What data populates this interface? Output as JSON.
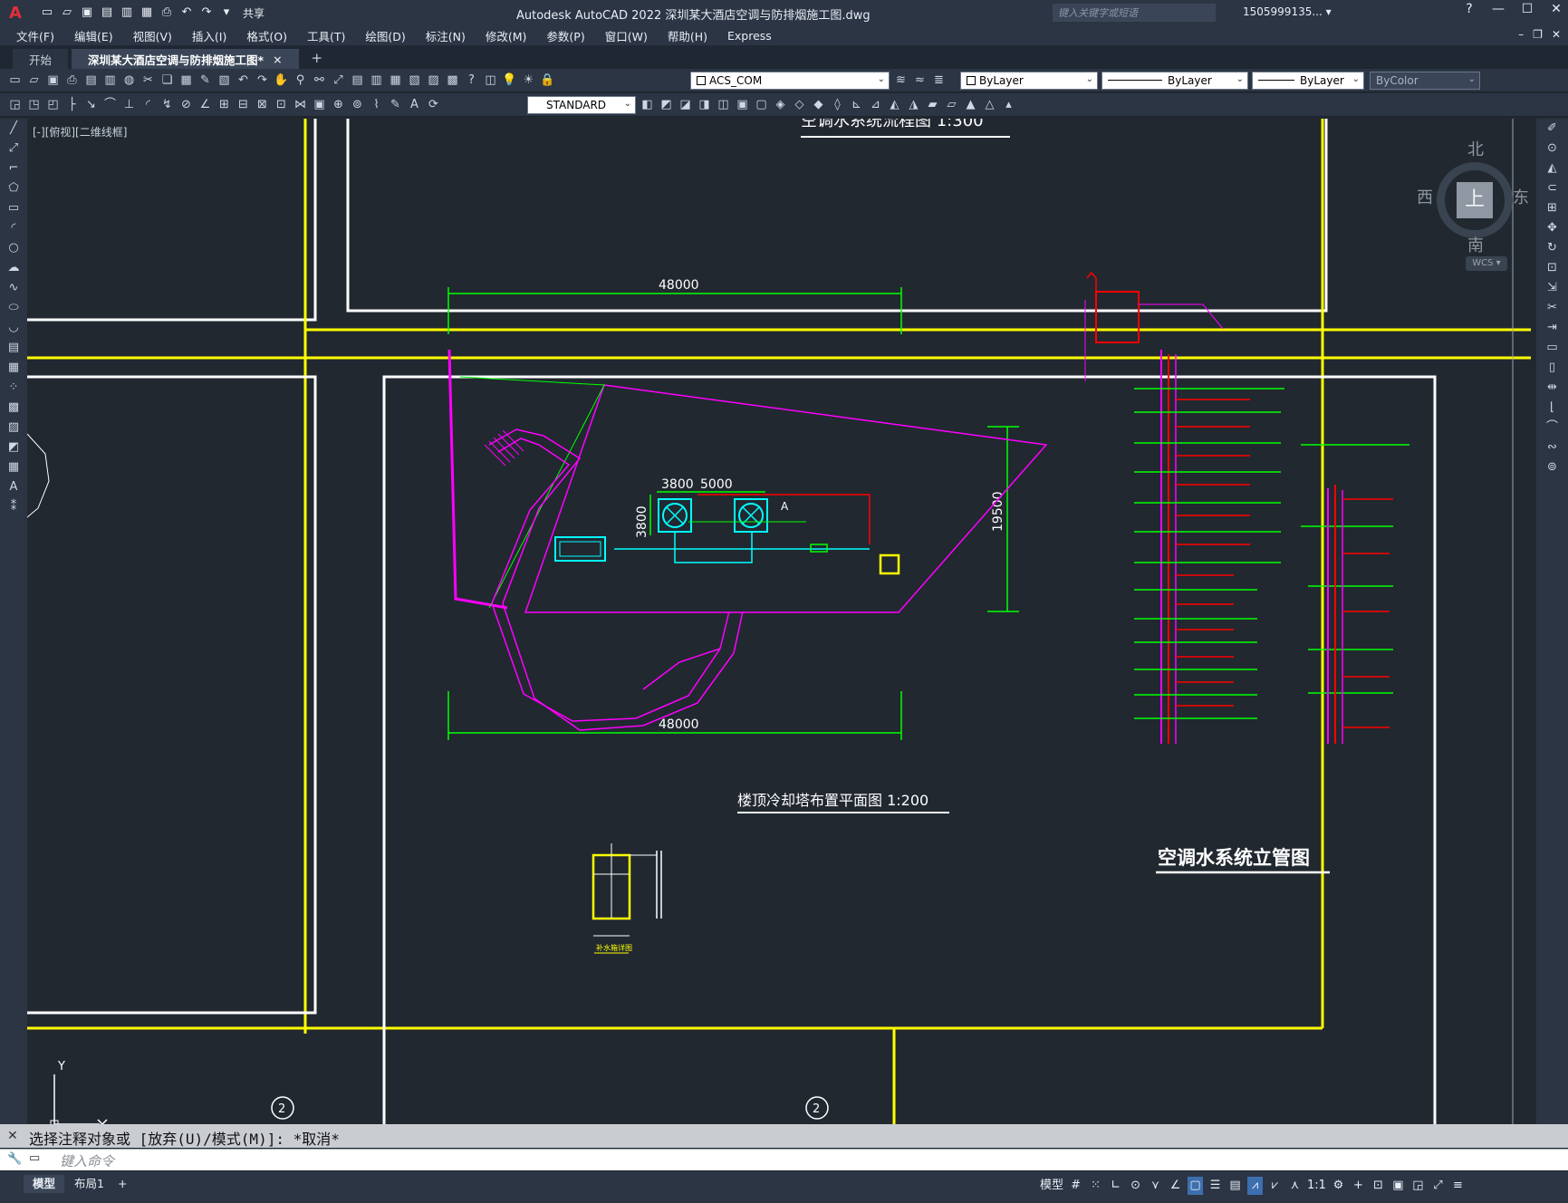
{
  "app": {
    "title": "Autodesk AutoCAD 2022    深圳某大酒店空调与防排烟施工图.dwg",
    "share_label": "共享",
    "search_placeholder": "键入关键字或短语",
    "user": "1505999135... ▾"
  },
  "menu": [
    "文件(F)",
    "编辑(E)",
    "视图(V)",
    "插入(I)",
    "格式(O)",
    "工具(T)",
    "绘图(D)",
    "标注(N)",
    "修改(M)",
    "参数(P)",
    "窗口(W)",
    "帮助(H)",
    "Express"
  ],
  "tabs": {
    "start": "开始",
    "active": "深圳某大酒店空调与防排烟施工图*",
    "close": "×",
    "add": "+"
  },
  "toolbar": {
    "layer_combo": "ACS_COM",
    "color_combo": "ByLayer",
    "linetype_combo": "ByLayer",
    "lineweight_combo": "ByLayer",
    "plotstyle_combo": "ByColor",
    "textstyle_combo": "STANDARD"
  },
  "canvas": {
    "view_label": "[-][俯视][二维线框]",
    "top_partial_title": "空调水系统流程图    1:300",
    "dims": {
      "top_width": "48000",
      "bottom_width": "48000",
      "right_height": "19500",
      "gap_a": "3800",
      "gap_b": "5000",
      "left_height": "3800"
    },
    "mark_a": "A",
    "plan_title": "楼顶冷却塔布置平面图 1:200",
    "riser_title": "空调水系统立管图",
    "detail_title": "补水箱详图",
    "grid_bubble_left": "2",
    "grid_bubble_right": "2",
    "ucs_y": "Y"
  },
  "viewcube": {
    "north": "北",
    "south": "南",
    "east": "东",
    "west": "西",
    "face": "上",
    "wcs": "WCS ▾"
  },
  "command": {
    "history": "选择注释对象或 [放弃(U)/模式(M)]: *取消*",
    "placeholder": "键入命令"
  },
  "status": {
    "model_tab": "模型",
    "layout_tab": "布局1",
    "add": "+",
    "model_btn": "模型",
    "scale": "1:1"
  },
  "colors": {
    "background": "#212830",
    "frame": "#ffffff",
    "border_yellow": "#ffff00",
    "dim_green": "#00ff00",
    "building_magenta": "#ff00ff",
    "pipe_cyan": "#00ffff",
    "pipe_red": "#ff0000"
  }
}
